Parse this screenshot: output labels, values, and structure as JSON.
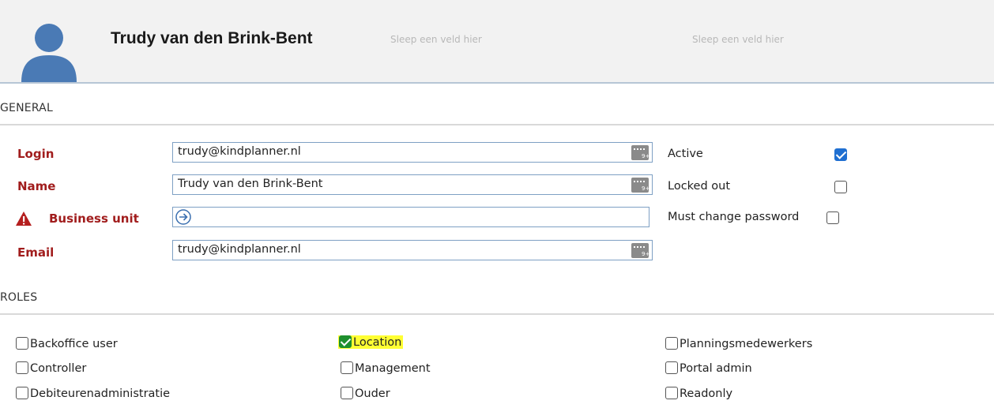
{
  "header": {
    "name": "Trudy van den Brink-Bent",
    "drop_zone_1": "Sleep een veld hier",
    "drop_zone_2": "Sleep een veld hier"
  },
  "sections": {
    "general": "GENERAL",
    "roles": "ROLES"
  },
  "fields": {
    "login": {
      "label": "Login",
      "value": "trudy@kindplanner.nl"
    },
    "name": {
      "label": "Name",
      "value": "Trudy van den Brink-Bent"
    },
    "business_unit": {
      "label": "Business unit",
      "value": ""
    },
    "email": {
      "label": "Email",
      "value": "trudy@kindplanner.nl"
    }
  },
  "flags": {
    "active": {
      "label": "Active",
      "checked": true
    },
    "locked_out": {
      "label": "Locked out",
      "checked": false
    },
    "must_change_password": {
      "label": "Must change password",
      "checked": false
    }
  },
  "roles": {
    "backoffice_user": {
      "label": "Backoffice user",
      "checked": false
    },
    "controller": {
      "label": "Controller",
      "checked": false
    },
    "debiteurenadministratie": {
      "label": "Debiteurenadministratie",
      "checked": false
    },
    "location": {
      "label": "Location",
      "checked": true
    },
    "management": {
      "label": "Management",
      "checked": false
    },
    "ouder": {
      "label": "Ouder",
      "checked": false
    },
    "planningsmedewerkers": {
      "label": "Planningsmedewerkers",
      "checked": false
    },
    "portal_admin": {
      "label": "Portal admin",
      "checked": false
    },
    "readonly": {
      "label": "Readonly",
      "checked": false
    }
  },
  "colors": {
    "required_label": "#a11d1d",
    "checkbox_checked": "#1f6fd1",
    "role_highlight": "#ffff33",
    "field_border": "#7ea0c4"
  }
}
